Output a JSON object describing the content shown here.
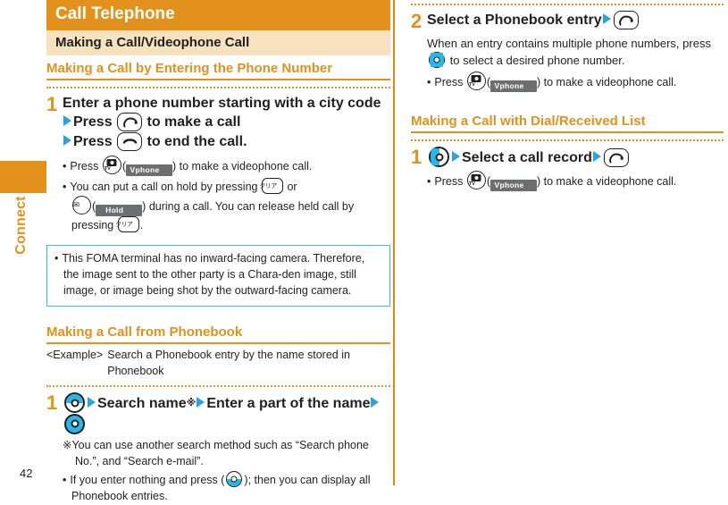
{
  "page": {
    "number": "42",
    "tab_label": "Connect"
  },
  "left_column": {
    "chapter_title": "Call Telephone",
    "section_title": "Making a Call/Videophone Call",
    "sub1": {
      "heading": "Making a Call by Entering the Phone Number",
      "step_number": "1",
      "step_text_a": "Enter a phone number starting with a city code",
      "step_text_b": "Press",
      "step_text_c": "to make a call",
      "step_text_d": "Press",
      "step_text_e": "to end the call.",
      "bullets": [
        {
          "pre": "Press",
          "softkey": "Vphone",
          "post": "to make a videophone call."
        },
        {
          "pre": "You can put a call on hold by pressing",
          "mid": "or",
          "softkey": "Hold",
          "post": "during a call. You can release held call by pressing",
          "tail": "."
        }
      ]
    },
    "note_box": {
      "text": "This FOMA terminal has no inward-facing camera. Therefore, the image sent to the other party is a Chara-den image, still image, or image being shot by the outward-facing camera."
    },
    "sub2": {
      "heading": "Making a Call from Phonebook",
      "example_tag": "<Example>",
      "example_text": "Search a Phonebook entry by the name stored in Phonebook",
      "step_number": "1",
      "step_text_a": "Search name",
      "step_marker": "※",
      "step_text_b": "Enter a part of the name",
      "footnote_marker": "※",
      "footnote_text": "You can use another search method such as “Search phone No.”, and “Search e-mail”.",
      "bullet_pre": "If you enter nothing and press",
      "bullet_post": "; then you can display all Phonebook entries."
    }
  },
  "right_column": {
    "step2": {
      "step_number": "2",
      "step_text": "Select a Phonebook entry",
      "para_a": "When an entry contains multiple phone numbers, press",
      "para_b": "to select a desired phone number.",
      "bullet": {
        "pre": "Press",
        "softkey": "Vphone",
        "post": "to make a videophone call."
      }
    },
    "sub3": {
      "heading": "Making a Call with Dial/Received List",
      "step_number": "1",
      "step_text": "Select a call record",
      "bullet": {
        "pre": "Press",
        "softkey": "Vphone",
        "post": "to make a videophone call."
      }
    }
  },
  "keys": {
    "clear_key_label": "クリア",
    "tv_label": "TV",
    "mail_label": "✉"
  },
  "colors": {
    "orange": "#e2911c",
    "orange_light": "#f6e2bf",
    "teal": "#3ec0cf",
    "blue": "#29b6e8",
    "arrow_blue": "#2aa4dd",
    "softkey_gray": "#6d6e71",
    "text": "#231f20"
  }
}
